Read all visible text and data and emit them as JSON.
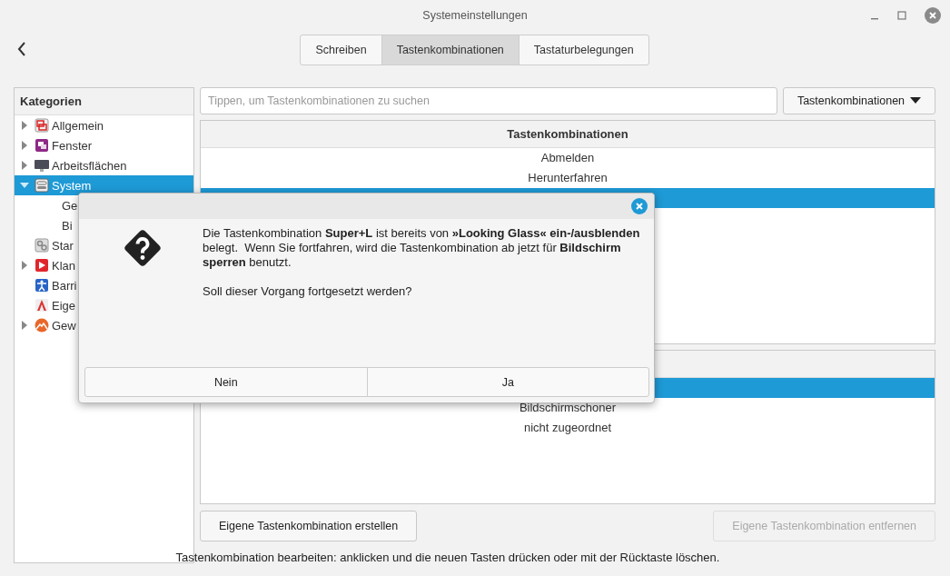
{
  "window": {
    "title": "Systemeinstellungen"
  },
  "tabs": [
    {
      "label": "Schreiben",
      "selected": false
    },
    {
      "label": "Tastenkombinationen",
      "selected": true
    },
    {
      "label": "Tastaturbelegungen",
      "selected": false
    }
  ],
  "sidebar": {
    "heading": "Kategorien",
    "items": [
      {
        "label": "Allgemein",
        "kind": "expander",
        "expanded": false,
        "selected": false
      },
      {
        "label": "Fenster",
        "kind": "expander",
        "expanded": false,
        "selected": false
      },
      {
        "label": "Arbeitsflächen",
        "kind": "expander",
        "expanded": false,
        "selected": false
      },
      {
        "label": "System",
        "kind": "expander",
        "expanded": true,
        "selected": true,
        "children": [
          {
            "label": "Ge",
            "selected": false
          },
          {
            "label": "Bi",
            "selected": false
          }
        ]
      },
      {
        "label": "Star",
        "kind": "leaf",
        "selected": false
      },
      {
        "label": "Klan",
        "kind": "expander",
        "expanded": false,
        "selected": false
      },
      {
        "label": "Barri",
        "kind": "leaf",
        "selected": false
      },
      {
        "label": "Eige",
        "kind": "leaf",
        "selected": false
      },
      {
        "label": "Gew",
        "kind": "expander",
        "expanded": false,
        "selected": false
      }
    ]
  },
  "search": {
    "placeholder": "Tippen, um Tastenkombinationen zu suchen"
  },
  "filter_button": {
    "label": "Tastenkombinationen"
  },
  "shortcuts_table": {
    "column": "Tastenkombinationen",
    "rows": [
      {
        "label": "Abmelden",
        "selected": false
      },
      {
        "label": "Herunterfahren",
        "selected": false
      },
      {
        "selected": true
      }
    ]
  },
  "bindings_table": {
    "rows": [
      {
        "selected": true
      },
      {
        "label": "Bildschirmschoner",
        "selected": false
      },
      {
        "label": "nicht zugeordnet",
        "selected": false
      }
    ]
  },
  "buttons": [
    {
      "label": "Eigene Tastenkombination erstellen",
      "disabled": false
    },
    {
      "label": "Eigene Tastenkombination entfernen",
      "disabled": true
    }
  ],
  "status_text": "Tastenkombination bearbeiten: anklicken und die neuen Tasten drücken oder mit der Rücktaste löschen.",
  "dialog": {
    "message": "Die Tastenkombination **Super+L** ist bereits von **»Looking Glass« ein-/ausblenden** belegt.  Wenn Sie fortfahren, wird die Tastenkombination ab jetzt für **Bildschirm sperren** benutzt.",
    "question": "Soll dieser Vorgang fortgesetzt werden?",
    "buttons": [
      "Nein",
      "Ja"
    ]
  }
}
